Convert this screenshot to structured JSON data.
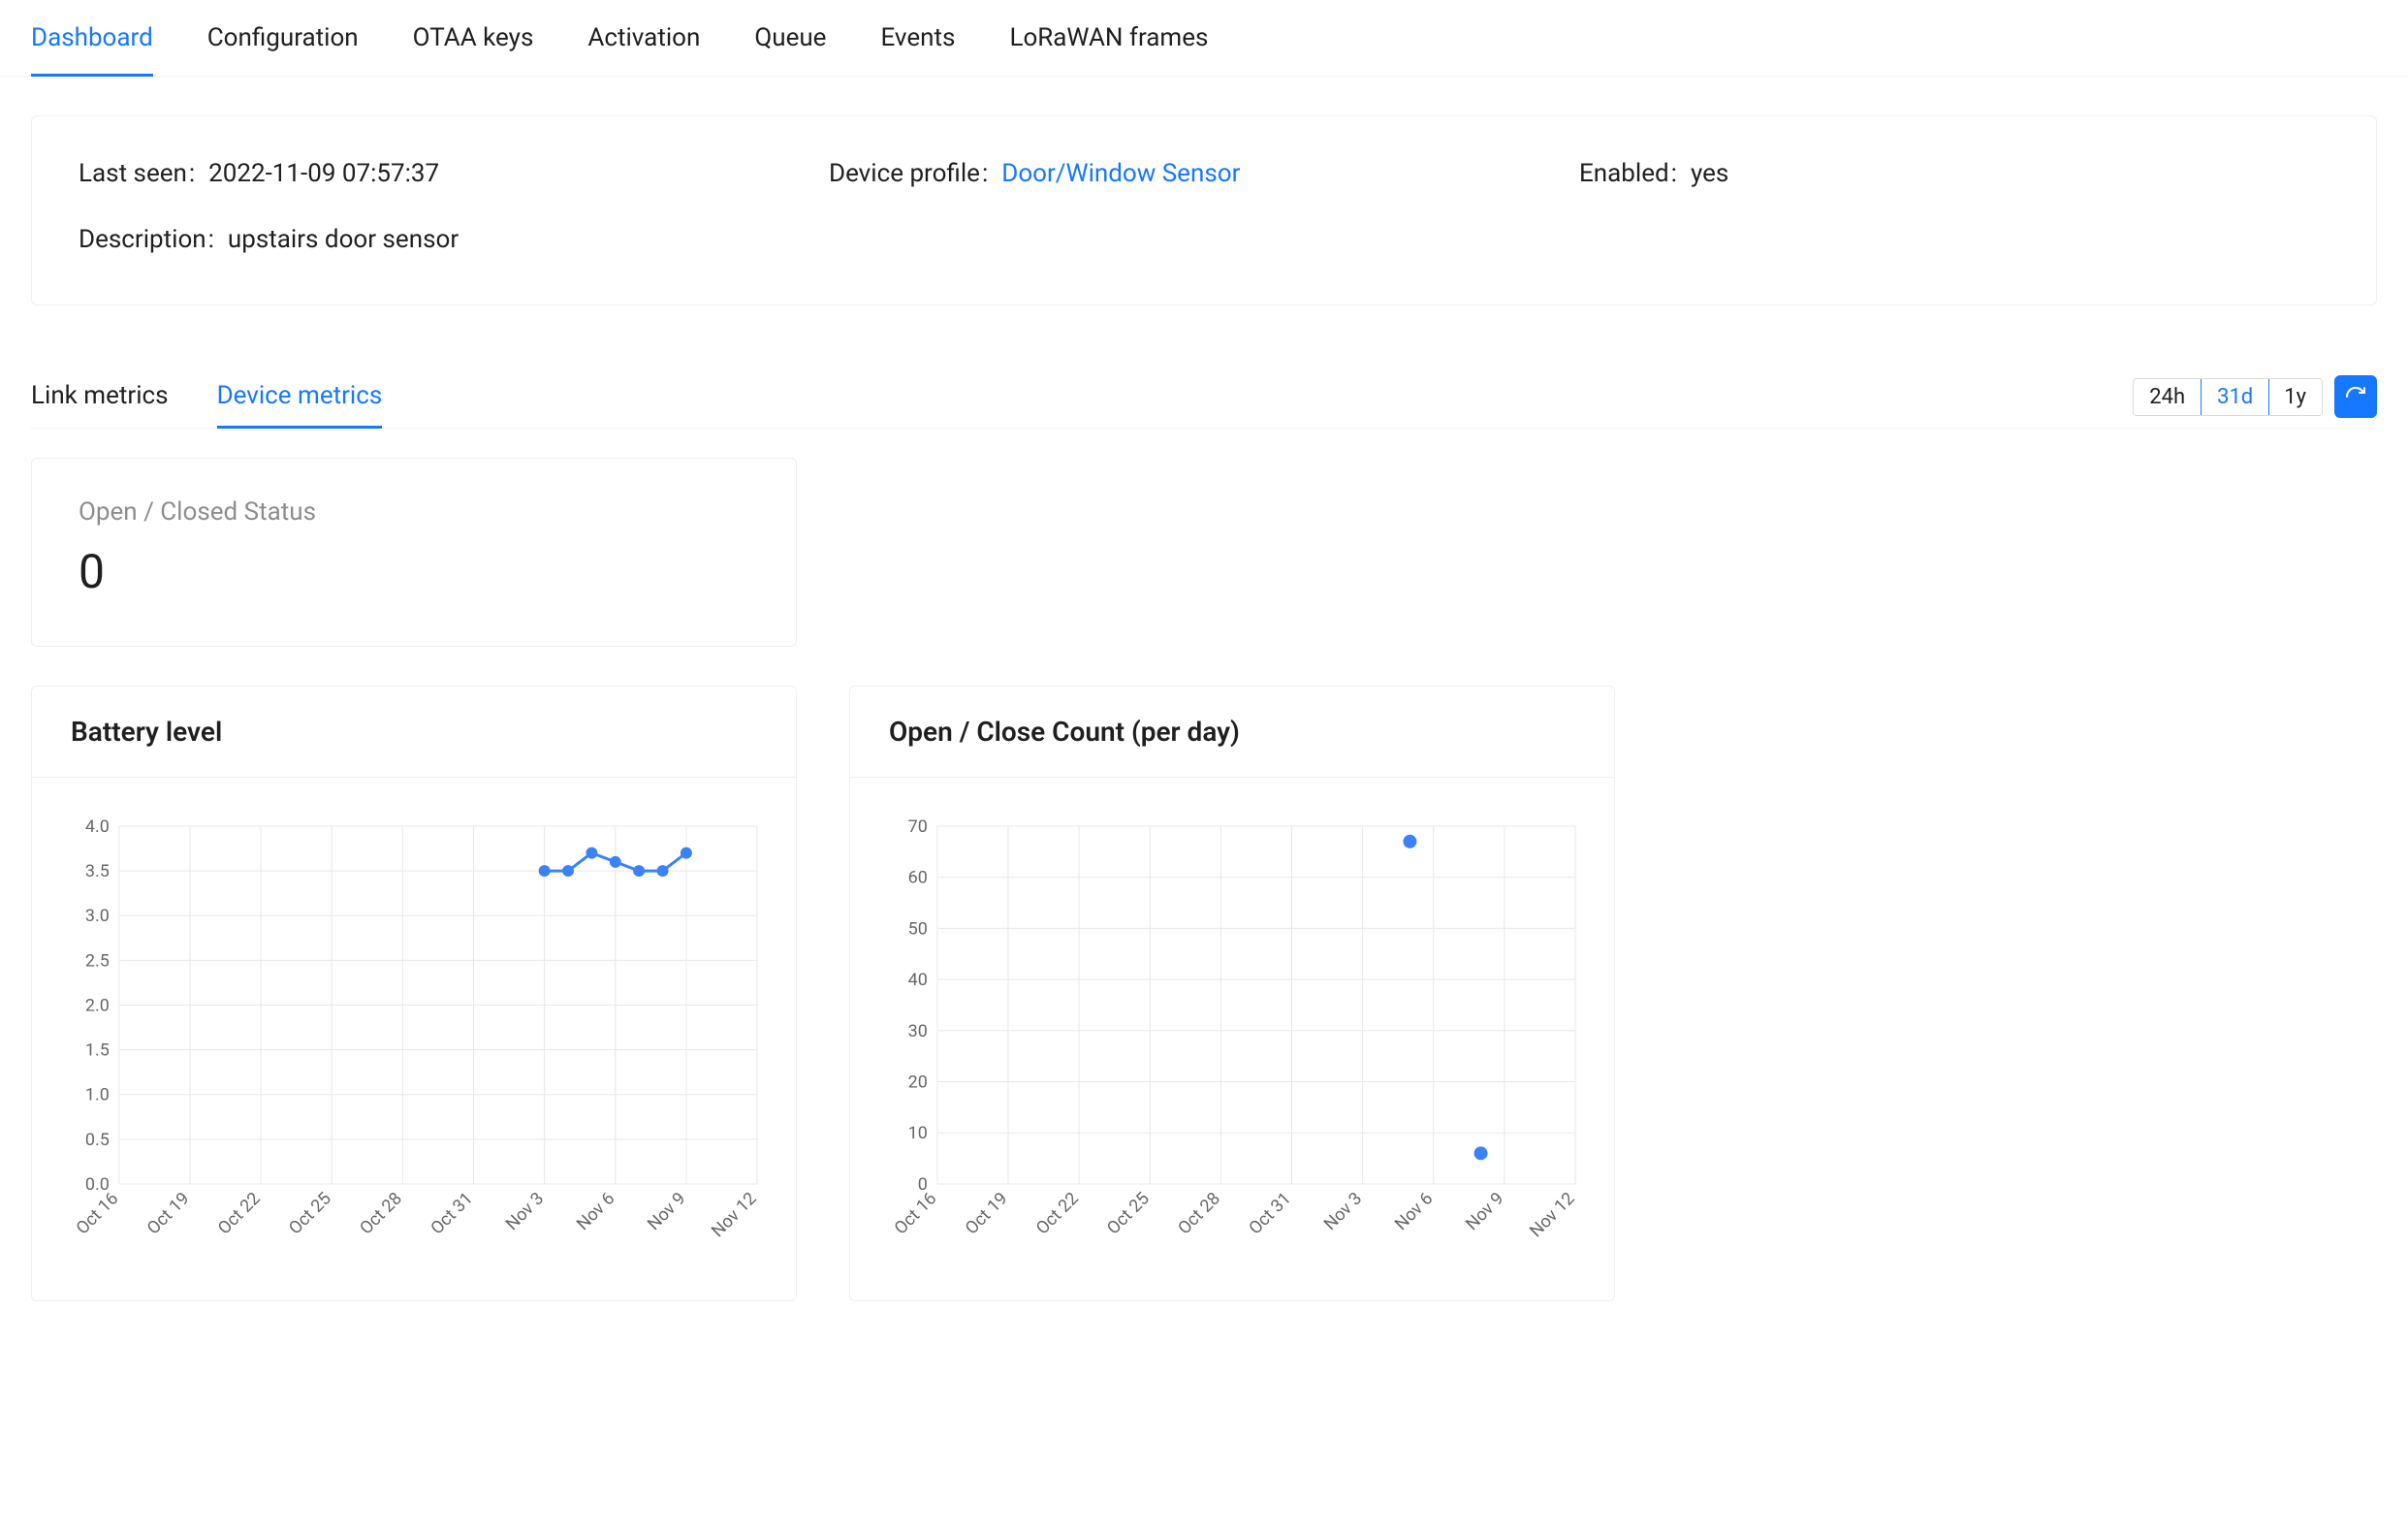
{
  "main_tabs": [
    {
      "key": "dashboard",
      "label": "Dashboard",
      "active": true
    },
    {
      "key": "configuration",
      "label": "Configuration",
      "active": false
    },
    {
      "key": "otaa",
      "label": "OTAA keys",
      "active": false
    },
    {
      "key": "activation",
      "label": "Activation",
      "active": false
    },
    {
      "key": "queue",
      "label": "Queue",
      "active": false
    },
    {
      "key": "events",
      "label": "Events",
      "active": false
    },
    {
      "key": "frames",
      "label": "LoRaWAN frames",
      "active": false
    }
  ],
  "info": {
    "last_seen_label": "Last seen",
    "last_seen_value": "2022-11-09 07:57:37",
    "device_profile_label": "Device profile",
    "device_profile_value": "Door/Window Sensor",
    "enabled_label": "Enabled",
    "enabled_value": "yes",
    "description_label": "Description",
    "description_value": "upstairs door sensor"
  },
  "metric_tabs": [
    {
      "key": "link",
      "label": "Link metrics",
      "active": false
    },
    {
      "key": "device",
      "label": "Device metrics",
      "active": true
    }
  ],
  "ranges": [
    {
      "key": "24h",
      "label": "24h",
      "active": false
    },
    {
      "key": "31d",
      "label": "31d",
      "active": true
    },
    {
      "key": "1y",
      "label": "1y",
      "active": false
    }
  ],
  "status_card": {
    "title": "Open / Closed Status",
    "value": "0"
  },
  "chart_data": [
    {
      "id": "battery",
      "type": "line",
      "title": "Battery level",
      "xlabel": "",
      "ylabel": "",
      "ylim": [
        0,
        4.0
      ],
      "yticks": [
        0,
        0.5,
        1.0,
        1.5,
        2.0,
        2.5,
        3.0,
        3.5,
        4.0
      ],
      "categories": [
        "Oct 16",
        "Oct 19",
        "Oct 22",
        "Oct 25",
        "Oct 28",
        "Oct 31",
        "Nov 3",
        "Nov 6",
        "Nov 9",
        "Nov 12"
      ],
      "points": [
        {
          "x": "Nov 3",
          "y": 3.5
        },
        {
          "x": "Nov 4",
          "y": 3.5
        },
        {
          "x": "Nov 5",
          "y": 3.7
        },
        {
          "x": "Nov 6",
          "y": 3.6
        },
        {
          "x": "Nov 7",
          "y": 3.5
        },
        {
          "x": "Nov 8",
          "y": 3.5
        },
        {
          "x": "Nov 9",
          "y": 3.7
        }
      ]
    },
    {
      "id": "opencount",
      "type": "scatter",
      "title": "Open / Close Count (per day)",
      "xlabel": "",
      "ylabel": "",
      "ylim": [
        0,
        70
      ],
      "yticks": [
        0,
        10,
        20,
        30,
        40,
        50,
        60,
        70
      ],
      "categories": [
        "Oct 16",
        "Oct 19",
        "Oct 22",
        "Oct 25",
        "Oct 28",
        "Oct 31",
        "Nov 3",
        "Nov 6",
        "Nov 9",
        "Nov 12"
      ],
      "points": [
        {
          "x": "Nov 5",
          "y": 67
        },
        {
          "x": "Nov 8",
          "y": 6
        }
      ]
    }
  ]
}
